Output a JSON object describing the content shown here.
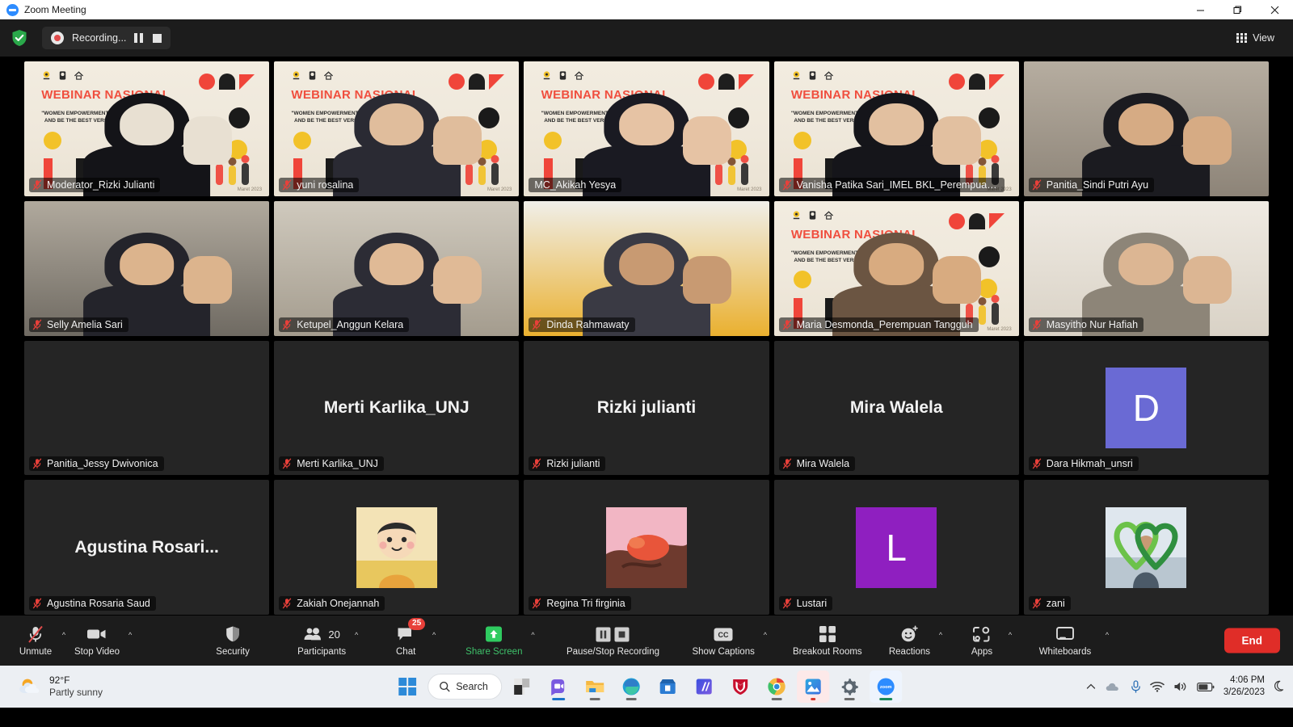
{
  "window": {
    "title": "Zoom Meeting",
    "logo_icon": "zoom-logo-icon",
    "minimize_label": "Minimize",
    "maximize_label": "Restore",
    "close_label": "Close"
  },
  "header": {
    "security_shield_icon": "encryption-shield-icon",
    "recording_label": "Recording...",
    "recording_dot_icon": "recording-indicator-icon",
    "pause_icon": "pause-recording-icon",
    "stop_icon": "stop-recording-icon",
    "view_label": "View",
    "view_icon": "grid-view-icon"
  },
  "colors": {
    "accent_green": "#3ec16a",
    "active_speaker_border": "#c8f04a",
    "end_button": "#e02d28",
    "badge_red": "#e8403a",
    "avatar_purple": "#6a6ad4",
    "banner_red": "#f04e3e",
    "banner_yellow": "#f2c229"
  },
  "banner": {
    "title": "WEBINAR NASIONAL",
    "subtitle_line1": "\"WOMEN EMPOWERMENT : OVERCOME INSECURITY",
    "subtitle_line2": "AND BE THE BEST VERSION OF YOU\"",
    "stamp": "Maret 2023"
  },
  "grid": {
    "tiles": [
      {
        "name": "Moderator_Rizki Julianti",
        "muted": true,
        "kind": "video-banner",
        "active": false,
        "banner": true
      },
      {
        "name": "yuni rosalina",
        "muted": true,
        "kind": "video-banner",
        "active": false,
        "banner": true
      },
      {
        "name": "MC_Akikah Yesya",
        "muted": false,
        "kind": "video-banner",
        "active": true,
        "banner": true
      },
      {
        "name": "Vanisha Patika Sari_IMEL BKL_Perempuan Tan...",
        "muted": true,
        "kind": "video-banner",
        "active": false,
        "banner": true
      },
      {
        "name": "Panitia_Sindi Putri Ayu",
        "muted": true,
        "kind": "video-room",
        "active": false,
        "banner": false
      },
      {
        "name": "Selly Amelia Sari",
        "muted": true,
        "kind": "video-room",
        "active": false,
        "banner": false
      },
      {
        "name": "Ketupel_Anggun Kelara",
        "muted": true,
        "kind": "video-room",
        "active": false,
        "banner": false
      },
      {
        "name": "Dinda Rahmawaty",
        "muted": true,
        "kind": "video-room",
        "active": false,
        "banner": false
      },
      {
        "name": "Maria Desmonda_Perempuan Tangguh",
        "muted": true,
        "kind": "video-banner",
        "active": false,
        "banner": true
      },
      {
        "name": "Masyitho Nur Hafiah",
        "muted": true,
        "kind": "video-room",
        "active": false,
        "banner": false
      },
      {
        "name": "Panitia_Jessy Dwivonica",
        "muted": true,
        "kind": "blank",
        "active": false,
        "display": ""
      },
      {
        "name": "Merti Karlika_UNJ",
        "muted": true,
        "kind": "name-avatar",
        "active": false,
        "display": "Merti Karlika_UNJ"
      },
      {
        "name": "Rizki julianti",
        "muted": true,
        "kind": "name-avatar",
        "active": false,
        "display": "Rizki julianti"
      },
      {
        "name": "Mira Walela",
        "muted": true,
        "kind": "name-avatar",
        "active": false,
        "display": "Mira Walela"
      },
      {
        "name": "Dara Hikmah_unsri",
        "muted": true,
        "kind": "letter-avatar",
        "active": false,
        "display": "D",
        "avatar_color": "#6a6ad4"
      },
      {
        "name": "Agustina Rosaria Saud",
        "muted": true,
        "kind": "name-avatar",
        "active": false,
        "display": "Agustina  Rosari..."
      },
      {
        "name": "Zakiah Onejannah",
        "muted": true,
        "kind": "picture-avatar",
        "active": false,
        "avatar": "cartoon-character-avatar"
      },
      {
        "name": "Regina Tri firginia",
        "muted": true,
        "kind": "picture-avatar",
        "active": false,
        "avatar": "illustration-avatar"
      },
      {
        "name": "Lustari",
        "muted": true,
        "kind": "letter-avatar",
        "active": false,
        "display": "L",
        "avatar_color": "#8f1fc0"
      },
      {
        "name": "zani",
        "muted": true,
        "kind": "picture-avatar",
        "active": false,
        "avatar": "heart-photo-avatar"
      }
    ]
  },
  "controls": {
    "mic": {
      "label": "Unmute",
      "icon": "microphone-muted-icon",
      "has_caret": true
    },
    "video": {
      "label": "Stop Video",
      "icon": "camera-icon",
      "has_caret": true
    },
    "security": {
      "label": "Security",
      "icon": "shield-icon",
      "has_caret": false
    },
    "participants": {
      "label": "Participants",
      "icon": "people-icon",
      "count": "20",
      "has_caret": true
    },
    "chat": {
      "label": "Chat",
      "icon": "chat-bubble-icon",
      "badge": "25",
      "has_caret": true
    },
    "share": {
      "label": "Share Screen",
      "icon": "share-screen-icon",
      "has_caret": true
    },
    "recording": {
      "label": "Pause/Stop Recording",
      "icon": "pause-stop-recording-icon",
      "has_caret": false
    },
    "captions": {
      "label": "Show Captions",
      "icon": "closed-captions-icon",
      "has_caret": true
    },
    "breakout": {
      "label": "Breakout Rooms",
      "icon": "breakout-rooms-icon",
      "has_caret": false
    },
    "reactions": {
      "label": "Reactions",
      "icon": "reactions-smiley-icon",
      "has_caret": true
    },
    "apps": {
      "label": "Apps",
      "icon": "apps-icon",
      "has_caret": true
    },
    "whiteboards": {
      "label": "Whiteboards",
      "icon": "whiteboard-icon",
      "has_caret": true
    },
    "end": {
      "label": "End"
    }
  },
  "taskbar": {
    "weather": {
      "temperature": "92°F",
      "condition": "Partly sunny",
      "icon": "partly-sunny-icon"
    },
    "start_icon": "windows-start-icon",
    "search_placeholder": "Search",
    "search_icon": "search-icon",
    "apps": [
      {
        "icon": "file-explorer-dark-icon",
        "running": false
      },
      {
        "icon": "meet-app-icon",
        "running": true
      },
      {
        "icon": "file-explorer-icon",
        "running": true
      },
      {
        "icon": "microsoft-edge-icon",
        "running": false
      },
      {
        "icon": "microsoft-store-icon",
        "running": false
      },
      {
        "icon": "blue-gradient-app-icon",
        "running": false
      },
      {
        "icon": "mcafee-shield-icon",
        "running": false
      },
      {
        "icon": "google-chrome-icon",
        "running": true
      },
      {
        "icon": "photos-app-icon",
        "running": true
      },
      {
        "icon": "settings-gear-icon",
        "running": true
      },
      {
        "icon": "zoom-app-icon",
        "running": true
      }
    ],
    "tray": {
      "chevron_icon": "show-hidden-icons-icon",
      "onedrive_icon": "onedrive-icon",
      "mic_icon": "microphone-in-use-icon",
      "wifi_icon": "wifi-icon",
      "volume_icon": "volume-icon",
      "battery_icon": "battery-icon",
      "notification_icon": "do-not-disturb-icon",
      "time": "4:06 PM",
      "date": "3/26/2023"
    }
  }
}
